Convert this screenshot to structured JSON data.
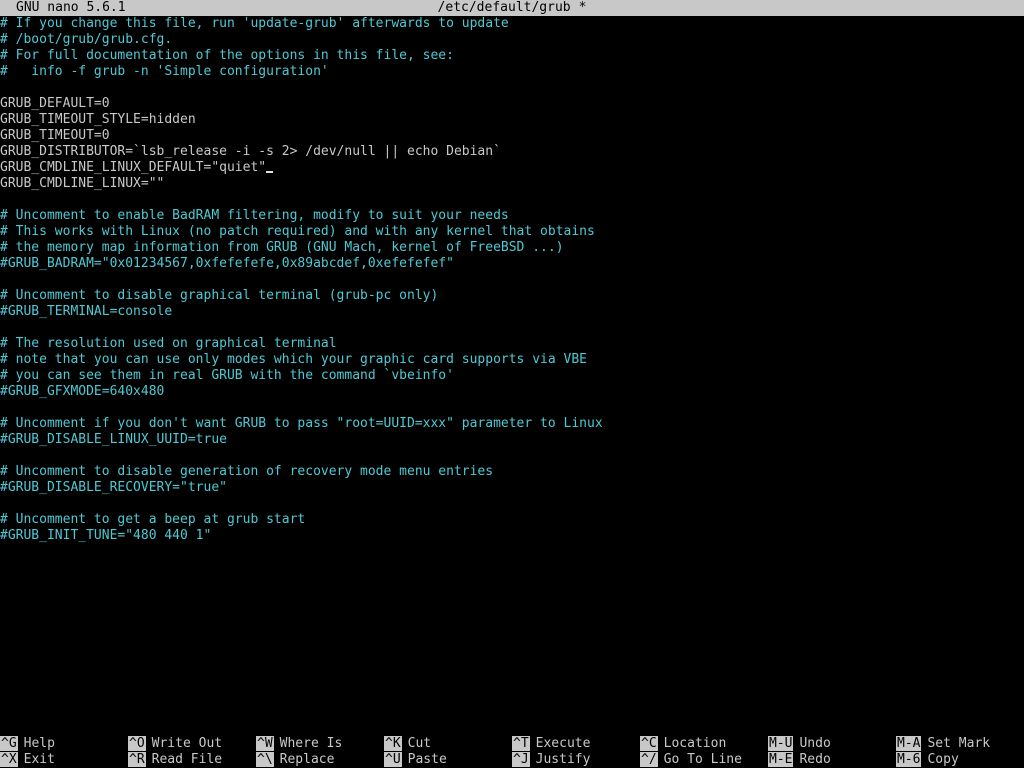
{
  "title_bar": {
    "app_name": "GNU nano 5.6.1",
    "file_path": "/etc/default/grub",
    "modified_flag": "*"
  },
  "editor": {
    "lines": [
      {
        "text": "# If you change this file, run 'update-grub' afterwards to update",
        "kind": "comment"
      },
      {
        "text": "# /boot/grub/grub.cfg.",
        "kind": "comment"
      },
      {
        "text": "# For full documentation of the options in this file, see:",
        "kind": "comment"
      },
      {
        "text": "#   info -f grub -n 'Simple configuration'",
        "kind": "comment"
      },
      {
        "text": "",
        "kind": "blank"
      },
      {
        "text": "GRUB_DEFAULT=0",
        "kind": "setting"
      },
      {
        "text": "GRUB_TIMEOUT_STYLE=hidden",
        "kind": "setting"
      },
      {
        "text": "GRUB_TIMEOUT=0",
        "kind": "setting"
      },
      {
        "text": "GRUB_DISTRIBUTOR=`lsb_release -i -s 2> /dev/null || echo Debian`",
        "kind": "setting"
      },
      {
        "text": "GRUB_CMDLINE_LINUX_DEFAULT=\"quiet\"",
        "kind": "setting",
        "cursor": true
      },
      {
        "text": "GRUB_CMDLINE_LINUX=\"\"",
        "kind": "setting"
      },
      {
        "text": "",
        "kind": "blank"
      },
      {
        "text": "# Uncomment to enable BadRAM filtering, modify to suit your needs",
        "kind": "comment"
      },
      {
        "text": "# This works with Linux (no patch required) and with any kernel that obtains",
        "kind": "comment"
      },
      {
        "text": "# the memory map information from GRUB (GNU Mach, kernel of FreeBSD ...)",
        "kind": "comment"
      },
      {
        "text": "#GRUB_BADRAM=\"0x01234567,0xfefefefe,0x89abcdef,0xefefefef\"",
        "kind": "comment"
      },
      {
        "text": "",
        "kind": "blank"
      },
      {
        "text": "# Uncomment to disable graphical terminal (grub-pc only)",
        "kind": "comment"
      },
      {
        "text": "#GRUB_TERMINAL=console",
        "kind": "comment"
      },
      {
        "text": "",
        "kind": "blank"
      },
      {
        "text": "# The resolution used on graphical terminal",
        "kind": "comment"
      },
      {
        "text": "# note that you can use only modes which your graphic card supports via VBE",
        "kind": "comment"
      },
      {
        "text": "# you can see them in real GRUB with the command `vbeinfo'",
        "kind": "comment"
      },
      {
        "text": "#GRUB_GFXMODE=640x480",
        "kind": "comment"
      },
      {
        "text": "",
        "kind": "blank"
      },
      {
        "text": "# Uncomment if you don't want GRUB to pass \"root=UUID=xxx\" parameter to Linux",
        "kind": "comment"
      },
      {
        "text": "#GRUB_DISABLE_LINUX_UUID=true",
        "kind": "comment"
      },
      {
        "text": "",
        "kind": "blank"
      },
      {
        "text": "# Uncomment to disable generation of recovery mode menu entries",
        "kind": "comment"
      },
      {
        "text": "#GRUB_DISABLE_RECOVERY=\"true\"",
        "kind": "comment"
      },
      {
        "text": "",
        "kind": "blank"
      },
      {
        "text": "# Uncomment to get a beep at grub start",
        "kind": "comment"
      },
      {
        "text": "#GRUB_INIT_TUNE=\"480 440 1\"",
        "kind": "comment"
      }
    ]
  },
  "help_bar": {
    "rows": [
      [
        {
          "key": "^G",
          "label": "Help"
        },
        {
          "key": "^O",
          "label": "Write Out"
        },
        {
          "key": "^W",
          "label": "Where Is"
        },
        {
          "key": "^K",
          "label": "Cut"
        },
        {
          "key": "^T",
          "label": "Execute"
        },
        {
          "key": "^C",
          "label": "Location"
        },
        {
          "key": "M-U",
          "label": "Undo"
        },
        {
          "key": "M-A",
          "label": "Set Mark"
        }
      ],
      [
        {
          "key": "^X",
          "label": "Exit"
        },
        {
          "key": "^R",
          "label": "Read File"
        },
        {
          "key": "^\\",
          "label": "Replace"
        },
        {
          "key": "^U",
          "label": "Paste"
        },
        {
          "key": "^J",
          "label": "Justify"
        },
        {
          "key": "^/",
          "label": "Go To Line"
        },
        {
          "key": "M-E",
          "label": "Redo"
        },
        {
          "key": "M-6",
          "label": "Copy"
        }
      ]
    ]
  },
  "colors": {
    "background": "#000000",
    "comment": "#4ec9d4",
    "setting": "#c8c8c8",
    "title_bar_bg": "#c8c8c8"
  }
}
